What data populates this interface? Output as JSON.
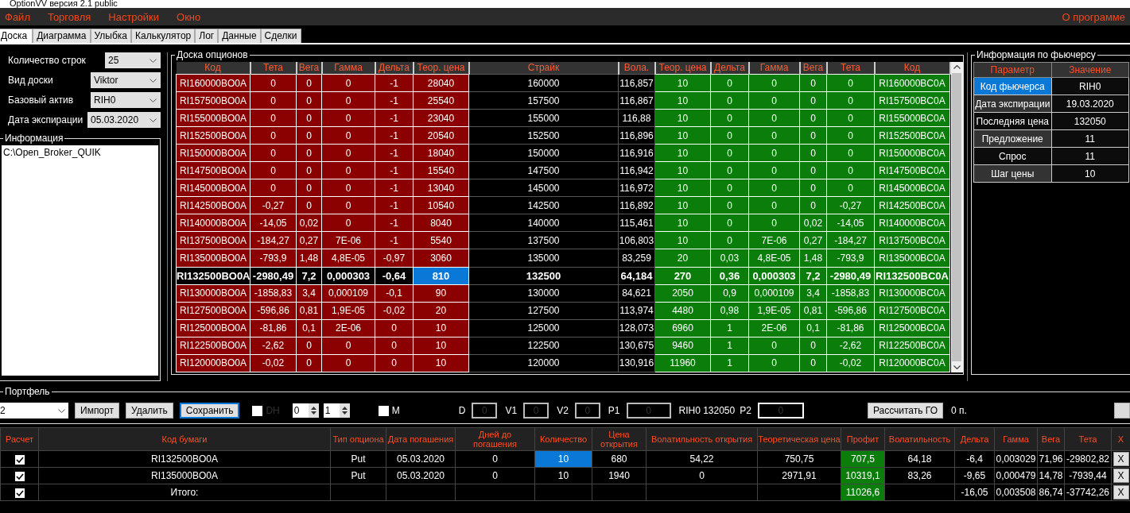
{
  "window": {
    "title": "OptionVV версия 2.1 public"
  },
  "menu": {
    "items": [
      "Файл",
      "Торговля",
      "Настройки",
      "Окно"
    ],
    "about": "О программе"
  },
  "tabs": [
    {
      "label": "Доска",
      "selected": true
    },
    {
      "label": "Диаграмма",
      "selected": false
    },
    {
      "label": "Улыбка",
      "selected": false
    },
    {
      "label": "Калькулятор",
      "selected": false
    },
    {
      "label": "Лог",
      "selected": false
    },
    {
      "label": "Данные",
      "selected": false
    },
    {
      "label": "Сделки",
      "selected": false
    }
  ],
  "settings": [
    {
      "label": "Количество строк",
      "value": "25"
    },
    {
      "label": "Вид доски",
      "value": "Viktor"
    },
    {
      "label": "Базовый актив",
      "value": "RIH0"
    },
    {
      "label": "Дата экспирации",
      "value": "05.03.2020"
    }
  ],
  "info": {
    "title": "Информация",
    "text": "C:\\Open_Broker_QUIK"
  },
  "board": {
    "title": "Доска опционов",
    "put_columns": [
      "Код",
      "Тета",
      "Вега",
      "Гамма",
      "Дельта",
      "Теор. цена"
    ],
    "center_columns": [
      "Страйк",
      "Вола."
    ],
    "call_columns": [
      "Теор. цена",
      "Дельта",
      "Гамма",
      "Вега",
      "Тета",
      "Код"
    ],
    "rows": [
      {
        "put": [
          "RI160000BO0A",
          "0",
          "0",
          "0",
          "-1",
          "28040"
        ],
        "strike": "160000",
        "vol": "116,857",
        "call": [
          "10",
          "0",
          "0",
          "0",
          "0",
          "RI160000BC0A"
        ],
        "atm": false,
        "selected": false
      },
      {
        "put": [
          "RI157500BO0A",
          "0",
          "0",
          "0",
          "-1",
          "25540"
        ],
        "strike": "157500",
        "vol": "116,867",
        "call": [
          "10",
          "0",
          "0",
          "0",
          "0",
          "RI157500BC0A"
        ],
        "atm": false,
        "selected": false
      },
      {
        "put": [
          "RI155000BO0A",
          "0",
          "0",
          "0",
          "-1",
          "23040"
        ],
        "strike": "155000",
        "vol": "116,88",
        "call": [
          "10",
          "0",
          "0",
          "0",
          "0",
          "RI155000BC0A"
        ],
        "atm": false,
        "selected": false
      },
      {
        "put": [
          "RI152500BO0A",
          "0",
          "0",
          "0",
          "-1",
          "20540"
        ],
        "strike": "152500",
        "vol": "116,896",
        "call": [
          "10",
          "0",
          "0",
          "0",
          "0",
          "RI152500BC0A"
        ],
        "atm": false,
        "selected": false
      },
      {
        "put": [
          "RI150000BO0A",
          "0",
          "0",
          "0",
          "-1",
          "18040"
        ],
        "strike": "150000",
        "vol": "116,916",
        "call": [
          "10",
          "0",
          "0",
          "0",
          "0",
          "RI150000BC0A"
        ],
        "atm": false,
        "selected": false
      },
      {
        "put": [
          "RI147500BO0A",
          "0",
          "0",
          "0",
          "-1",
          "15540"
        ],
        "strike": "147500",
        "vol": "116,942",
        "call": [
          "10",
          "0",
          "0",
          "0",
          "0",
          "RI147500BC0A"
        ],
        "atm": false,
        "selected": false
      },
      {
        "put": [
          "RI145000BO0A",
          "0",
          "0",
          "0",
          "-1",
          "13040"
        ],
        "strike": "145000",
        "vol": "116,972",
        "call": [
          "10",
          "0",
          "0",
          "0",
          "0",
          "RI145000BC0A"
        ],
        "atm": false,
        "selected": false
      },
      {
        "put": [
          "RI142500BO0A",
          "-0,27",
          "0",
          "0",
          "-1",
          "10540"
        ],
        "strike": "142500",
        "vol": "116,892",
        "call": [
          "10",
          "0",
          "0",
          "0",
          "-0,27",
          "RI142500BC0A"
        ],
        "atm": false,
        "selected": false
      },
      {
        "put": [
          "RI140000BO0A",
          "-14,05",
          "0,02",
          "0",
          "-1",
          "8040"
        ],
        "strike": "140000",
        "vol": "115,461",
        "call": [
          "10",
          "0",
          "0",
          "0,02",
          "-14,05",
          "RI140000BC0A"
        ],
        "atm": false,
        "selected": false
      },
      {
        "put": [
          "RI137500BO0A",
          "-184,27",
          "0,27",
          "7E-06",
          "-1",
          "5540"
        ],
        "strike": "137500",
        "vol": "106,803",
        "call": [
          "10",
          "0",
          "7E-06",
          "0,27",
          "-184,27",
          "RI137500BC0A"
        ],
        "atm": false,
        "selected": false
      },
      {
        "put": [
          "RI135000BO0A",
          "-793,9",
          "1,48",
          "4,8E-05",
          "-0,97",
          "3060"
        ],
        "strike": "135000",
        "vol": "83,259",
        "call": [
          "20",
          "0,03",
          "4,8E-05",
          "1,48",
          "-793,9",
          "RI135000BC0A"
        ],
        "atm": false,
        "selected": false
      },
      {
        "put": [
          "RI132500BO0A",
          "-2980,49",
          "7,2",
          "0,000303",
          "-0,64",
          "810"
        ],
        "strike": "132500",
        "vol": "64,184",
        "call": [
          "270",
          "0,36",
          "0,000303",
          "7,2",
          "-2980,49",
          "RI132500BC0A"
        ],
        "atm": true,
        "selected": true
      },
      {
        "put": [
          "RI130000BO0A",
          "-1858,83",
          "3,4",
          "0,000109",
          "-0,1",
          "90"
        ],
        "strike": "130000",
        "vol": "84,621",
        "call": [
          "2050",
          "0,9",
          "0,000109",
          "3,4",
          "-1858,83",
          "RI130000BC0A"
        ],
        "atm": false,
        "selected": false
      },
      {
        "put": [
          "RI127500BO0A",
          "-596,86",
          "0,81",
          "1,9E-05",
          "-0,02",
          "20"
        ],
        "strike": "127500",
        "vol": "113,974",
        "call": [
          "4480",
          "0,98",
          "1,9E-05",
          "0,81",
          "-596,86",
          "RI127500BC0A"
        ],
        "atm": false,
        "selected": false
      },
      {
        "put": [
          "RI125000BO0A",
          "-81,86",
          "0,1",
          "2E-06",
          "0",
          "10"
        ],
        "strike": "125000",
        "vol": "128,073",
        "call": [
          "6960",
          "1",
          "2E-06",
          "0,1",
          "-81,86",
          "RI125000BC0A"
        ],
        "atm": false,
        "selected": false
      },
      {
        "put": [
          "RI122500BO0A",
          "-2,62",
          "0",
          "0",
          "0",
          "10"
        ],
        "strike": "122500",
        "vol": "130,675",
        "call": [
          "9460",
          "1",
          "0",
          "0",
          "-2,62",
          "RI122500BC0A"
        ],
        "atm": false,
        "selected": false
      },
      {
        "put": [
          "RI120000BO0A",
          "-0,02",
          "0",
          "0",
          "0",
          "10"
        ],
        "strike": "120000",
        "vol": "130,916",
        "call": [
          "11960",
          "1",
          "0",
          "0",
          "-0,02",
          "RI120000BC0A"
        ],
        "atm": false,
        "selected": false
      }
    ]
  },
  "future": {
    "title": "Информация по фьючерсу",
    "columns": [
      "Параметр",
      "Значение"
    ],
    "rows": [
      {
        "param": "Код фьючерса",
        "value": "RIH0",
        "selected": true
      },
      {
        "param": "Дата экспирации",
        "value": "19.03.2020",
        "selected": false
      },
      {
        "param": "Последняя цена",
        "value": "132050",
        "selected": false
      },
      {
        "param": "Предложение",
        "value": "11",
        "selected": false
      },
      {
        "param": "Спрос",
        "value": "11",
        "selected": false
      },
      {
        "param": "Шаг цены",
        "value": "10",
        "selected": false
      }
    ]
  },
  "portfolio": {
    "title": "Портфель",
    "selector": "2",
    "buttons": [
      {
        "label": "Импорт",
        "focused": false
      },
      {
        "label": "Удалить",
        "focused": false
      },
      {
        "label": "Сохранить",
        "focused": true
      }
    ],
    "dh": {
      "label": "DH",
      "checked": false,
      "disabled": true
    },
    "spinners": [
      "0",
      "1"
    ],
    "m": {
      "label": "M",
      "checked": false,
      "disabled": false
    },
    "fields": [
      {
        "label": "D",
        "value": "0"
      },
      {
        "label": "V1",
        "value": "0"
      },
      {
        "label": "V2",
        "value": "0"
      },
      {
        "label": "P1",
        "value": "0"
      }
    ],
    "quote": "RIH0 132050",
    "p2": {
      "label": "P2",
      "value": "0"
    },
    "calc_button": "Рассчитать ГО",
    "margin": "0 п."
  },
  "positions": {
    "check_column": "Расчет",
    "close_column": "X",
    "columns": [
      "Код бумаги",
      "Тип опциона",
      "Дата погашения",
      "Дней до погашения",
      "Количество",
      "Цена открытия",
      "Волатильность открытия",
      "Теоретическая цена",
      "Профит",
      "Волатильность",
      "Дельта",
      "Гамма",
      "Вега",
      "Тета"
    ],
    "rows": [
      {
        "checked": true,
        "cells": [
          "RI132500BO0A",
          "Put",
          "05.03.2020",
          "0",
          "10",
          "680",
          "54,22",
          "750,75",
          "707,5",
          "64,18",
          "-6,4",
          "0,003029",
          "71,96",
          "-29802,82"
        ],
        "close": "X",
        "selected": true
      },
      {
        "checked": true,
        "cells": [
          "RI135000BO0A",
          "Put",
          "05.03.2020",
          "0",
          "10",
          "1940",
          "0",
          "2971,91",
          "10319,1",
          "83,26",
          "-9,65",
          "0,000479",
          "14,78",
          "-7939,44"
        ],
        "close": "X",
        "selected": false
      },
      {
        "checked": true,
        "cells": [
          "Итого:",
          "",
          "",
          "",
          "",
          "",
          "",
          "",
          "11026,6",
          "",
          "-16,05",
          "0,003508",
          "86,74",
          "-37742,26"
        ],
        "close": "X",
        "selected": false
      }
    ]
  }
}
